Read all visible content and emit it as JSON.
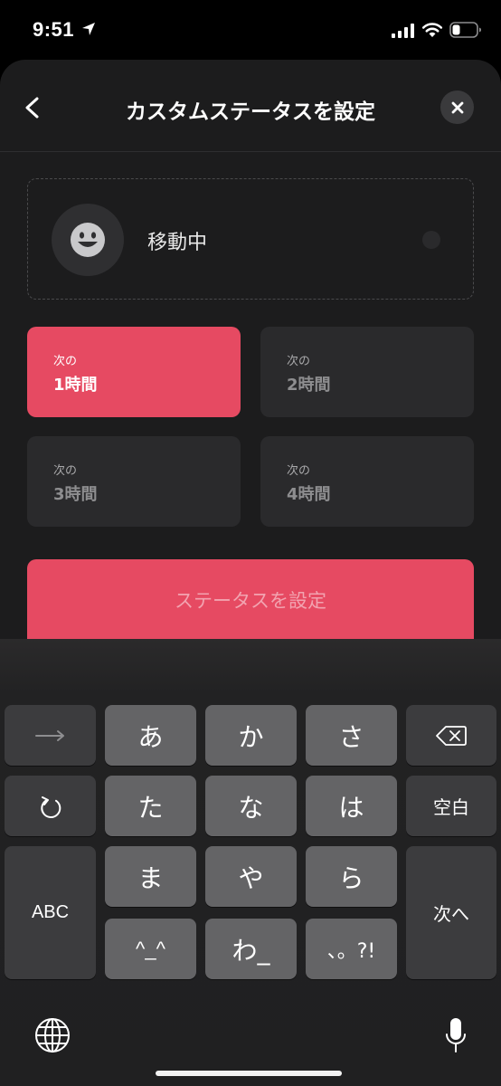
{
  "status_bar": {
    "time": "9:51"
  },
  "sheet": {
    "title": "カスタムステータスを設定",
    "status": {
      "text": "移動中"
    },
    "durations": [
      {
        "small": "次の",
        "big": "1時間",
        "selected": true
      },
      {
        "small": "次の",
        "big": "2時間",
        "selected": false
      },
      {
        "small": "次の",
        "big": "3時間",
        "selected": false
      },
      {
        "small": "次の",
        "big": "4時間",
        "selected": false
      }
    ],
    "set_button_label": "ステータスを設定"
  },
  "keyboard": {
    "keys": {
      "a": "あ",
      "ka": "か",
      "sa": "さ",
      "ta": "た",
      "na": "な",
      "ha": "は",
      "space": "空白",
      "abc": "ABC",
      "ma": "ま",
      "ya": "や",
      "ra": "ら",
      "next": "次へ",
      "kaomoji": "^_^",
      "wa": "わ_",
      "punct": "、。?!"
    }
  },
  "colors": {
    "accent": "#e64a62",
    "sheet_bg": "#1c1c1d",
    "key_bg": "#646466",
    "key_dark": "#3c3c3e"
  }
}
